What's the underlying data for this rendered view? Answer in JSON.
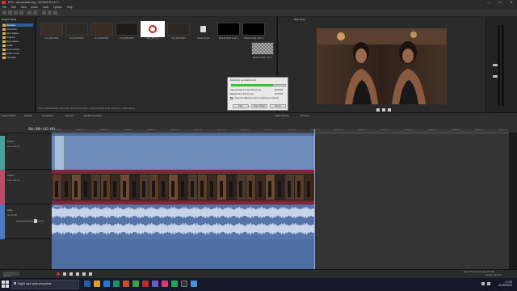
{
  "window": {
    "title": "8TS - vai-ouvindo.veg - VEGAS Pro 17.0",
    "minimize": "—",
    "maximize": "☐",
    "close": "✕"
  },
  "menu": [
    "File",
    "Edit",
    "View",
    "Insert",
    "Tools",
    "Options",
    "Help"
  ],
  "explorer": {
    "address": "Project Media",
    "tree": [
      "Desktop",
      "OneDrive",
      "Intro Dados",
      "Projetos",
      "Exportados",
      "Aulas",
      "Documentos",
      "Vídeo Aulas",
      "Vinhetas"
    ]
  },
  "media_bin": {
    "items": [
      {
        "label": "DJI_0021.MP4"
      },
      {
        "label": "DJI_0022.MP4"
      },
      {
        "label": "DJI_0023.MP4"
      },
      {
        "label": "DJI_0024.MP4"
      },
      {
        "label": "logo_8ts.png"
      },
      {
        "label": "DJI_0025.MP4"
      },
      {
        "label": "Audio 01.wav"
      },
      {
        "label": "VEGAS Solid Color 1"
      },
      {
        "label": "VEGAS Solid Color 2"
      },
      {
        "label": "VEGAS Solid Color 3"
      },
      {
        "label": "VEGAS Title & Text 1"
      }
    ],
    "info": "Video: 1920x1080x32, 29,970 fps, 00:00:16;00, Alpha = None (Straight) Audio: 48.000 Hz, 16 Bit, Stereo"
  },
  "preview": {
    "mode": "Best (Full)",
    "project_label": "Project:",
    "project_value": "1920x1080x32, 29,970p",
    "preview_label": "Preview:",
    "preview_value": "1920x1080x32, 29,970p",
    "frame_label": "Frame:",
    "frame_value": "479",
    "display_label": "Display:",
    "display_value": "597x336x32"
  },
  "dialog": {
    "title": "Rendering vai-ouvindo.mp4",
    "progress": 0.76,
    "approx_label": "Approximate time left (hh:mm:ss):",
    "approx_value": "00:00:06",
    "elapsed_label": "Elapsed time (hh:mm:ss):",
    "elapsed_value": "00:00:20",
    "checkbox": "Close this dialog box when rendering completes",
    "buttons": [
      "Open",
      "Open Folder",
      "Cancel"
    ]
  },
  "tabs": [
    "Project Media",
    "Explorer",
    "Transitions",
    "Video FX",
    "Media Generators",
    "Video Preview",
    "Trimmer"
  ],
  "timeline": {
    "timecode": "00:00:16:00",
    "ticks": [
      "00:00:00;00",
      "00:00:01;29",
      "00:00:03;29",
      "00:00:05;29",
      "00:00:07;29",
      "00:00:09;29",
      "00:00:11;29",
      "00:00:13;29",
      "00:00:15;29",
      "00:00:17;29",
      "00:00:19;29",
      "00:00:21;29",
      "00:00:23;29",
      "00:00:25;29",
      "00:00:27;29",
      "00:00:29;29",
      "00:00:31;29",
      "00:00:33;29",
      "00:00:35;29",
      "00:00:37;29"
    ],
    "tracks": [
      {
        "name": "Track 1",
        "level": "Level: 100,0 %"
      },
      {
        "name": "Track 2",
        "level": "Level: 100,0 %"
      },
      {
        "name": "Audio",
        "level": "Vol: 0,0 dB"
      }
    ],
    "audio_clip_label": "Audio 01",
    "rate": "Rate: 0,00"
  },
  "status": {
    "record_time": "Record Time (2 channels): 17:45:55",
    "complete": "Complete: 00:00:19"
  },
  "taskbar": {
    "search_placeholder": "Digite aqui para pesquisar",
    "time": "17:25",
    "date": "01/09/2020"
  },
  "colors": {
    "video_track1": "#6c8bb8",
    "video_track2": "#7c2838",
    "audio_track": "#5574a8",
    "progress": "#35c23a",
    "taskbar": "#14192a"
  }
}
